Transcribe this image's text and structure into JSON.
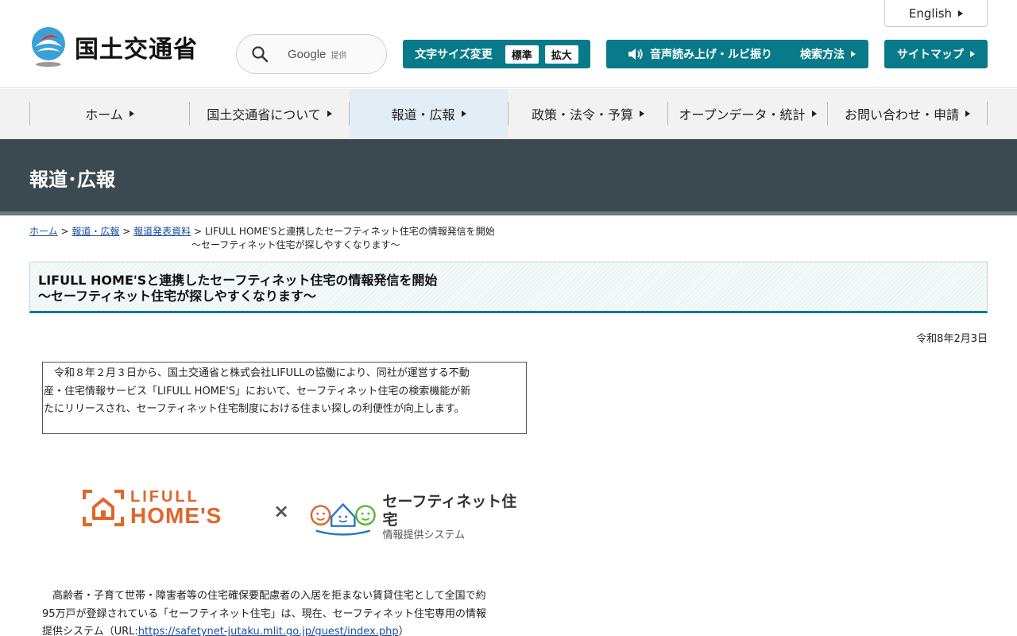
{
  "header": {
    "site_name": "国土交通省",
    "search": {
      "brand": "Google",
      "suffix": "提供"
    },
    "english_label": "English",
    "font_size": {
      "label": "文字サイズ変更",
      "standard": "標準",
      "large": "拡大"
    },
    "read_aloud_label": "音声読み上げ・ルビ振り",
    "search_method_label": "検索方法",
    "sitemap_label": "サイトマップ"
  },
  "nav": {
    "items": [
      {
        "label": "ホーム"
      },
      {
        "label": "国土交通省について"
      },
      {
        "label": "報道・広報"
      },
      {
        "label": "政策・法令・予算"
      },
      {
        "label": "オープンデータ・統計"
      },
      {
        "label": "お問い合わせ・申請"
      }
    ]
  },
  "banner": {
    "title": "報道･広報"
  },
  "breadcrumb": {
    "home": "ホーム",
    "press": "報道・広報",
    "releases": "報道発表資料",
    "current_line1": "LIFULL HOME'Sと連携したセーフティネット住宅の情報発信を開始",
    "current_line2": "～セーフティネット住宅が探しやすくなります～"
  },
  "article": {
    "title_line1": "LIFULL HOME'Sと連携したセーフティネット住宅の情報発信を開始",
    "title_line2": "～セーフティネット住宅が探しやすくなります～",
    "date": "令和8年2月3日",
    "summary": "　令和８年２月３日から、国土交通省と株式会社LIFULLの協働により、同社が運営する不動産・住宅情報サービス「LIFULL HOME'S」において、セーフティネット住宅の検索機能が新たにリリースされ、セーフティネット住宅制度における住まい探しの利便性が向上します。",
    "logo_left": {
      "line1": "LIFULL",
      "line2": "HOME'S"
    },
    "logo_times": "×",
    "logo_right": {
      "line1": "セーフティネット住宅",
      "line2": "情報提供システム"
    },
    "body_text": "　高齢者・子育て世帯・障害者等の住宅確保要配慮者の入居を拒まない賃貸住宅として全国で約95万戸が登録されている「セーフティネット住宅」は、現在、セーフティネット住宅専用の情報提供システム（URL:",
    "body_link": "https://safetynet-jutaku.mlit.go.jp/guest/index.php",
    "body_after": "）"
  },
  "colors": {
    "teal": "#087a8a",
    "banner": "#3b4a50",
    "lifull_orange": "#e0662a",
    "link": "#1a4ca0"
  }
}
